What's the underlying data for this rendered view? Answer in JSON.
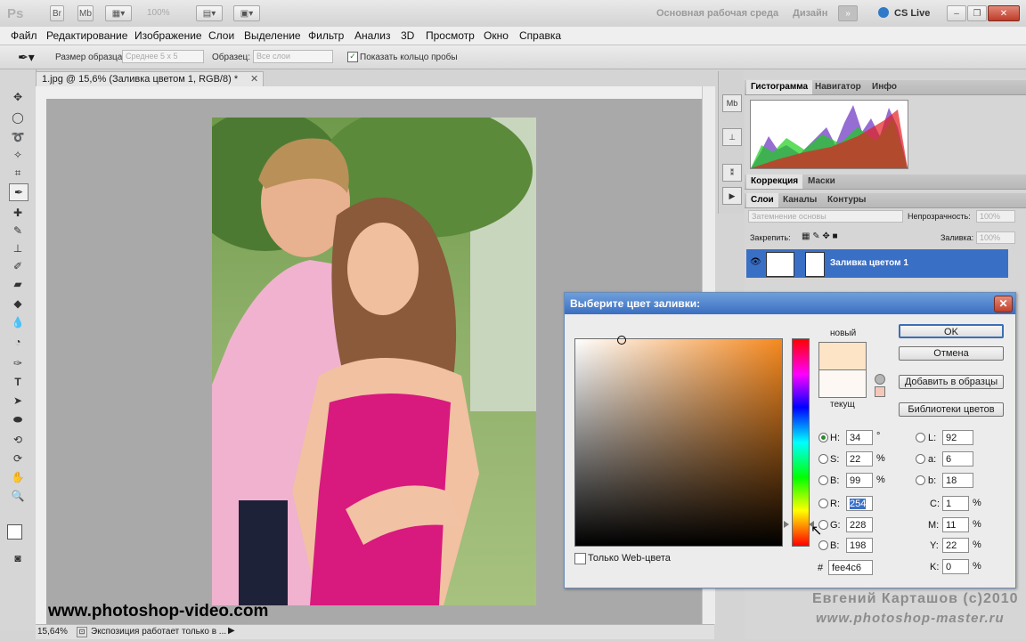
{
  "app": {
    "logo": "Ps",
    "zoom": "100%"
  },
  "titlebar": {
    "workspace_main": "Основная рабочая среда",
    "workspace_design": "Дизайн",
    "cs_live": "CS Live"
  },
  "menu": [
    "Файл",
    "Редактирование",
    "Изображение",
    "Слои",
    "Выделение",
    "Фильтр",
    "Анализ",
    "3D",
    "Просмотр",
    "Окно",
    "Справка"
  ],
  "options": {
    "sample_size_label": "Размер образца:",
    "sample_size_value": "Среднее 5 х 5",
    "sample_label": "Образец:",
    "sample_value": "Все слои",
    "show_ring": "Показать кольцо пробы"
  },
  "document": {
    "tab_title": "1.jpg @ 15,6% (Заливка цветом 1, RGB/8) *",
    "status_zoom": "15,64%",
    "status_text": "Экспозиция работает только в ..."
  },
  "watermark": {
    "site": "www.photoshop-video.com",
    "author": "Евгений Карташов (c)2010",
    "author_site": "www.photoshop-master.ru"
  },
  "panels": {
    "histogram_tabs": [
      "Гистограмма",
      "Навигатор",
      "Инфо"
    ],
    "correction_tabs": [
      "Коррекция",
      "Маски"
    ],
    "layers_tabs": [
      "Слои",
      "Каналы",
      "Контуры"
    ],
    "blend_mode": "Затемнение основы",
    "opacity_label": "Непрозрачность:",
    "opacity_value": "100%",
    "lock_label": "Закрепить:",
    "fill_label": "Заливка:",
    "fill_value": "100%",
    "layer_name": "Заливка цветом 1"
  },
  "dialog": {
    "title": "Выберите цвет заливки:",
    "new_label": "новый",
    "current_label": "текущ",
    "new_color": "#fee4c6",
    "current_color": "#fef8f4",
    "buttons": {
      "ok": "OK",
      "cancel": "Отмена",
      "add_swatch": "Добавить в образцы",
      "libraries": "Библиотеки цветов"
    },
    "web_only": "Только Web-цвета",
    "fields": {
      "H": "34",
      "S": "22",
      "B": "99",
      "R": "254",
      "G": "228",
      "Bv": "198",
      "L": "92",
      "a": "6",
      "b": "18",
      "C": "1",
      "M": "11",
      "Y": "22",
      "K": "0",
      "hex": "fee4c6"
    },
    "units": {
      "deg": "°",
      "pct": "%"
    },
    "labels": {
      "H": "H:",
      "S": "S:",
      "B": "B:",
      "R": "R:",
      "G": "G:",
      "Bv": "B:",
      "L": "L:",
      "a": "a:",
      "b": "b:",
      "C": "C:",
      "M": "M:",
      "Y": "Y:",
      "K": "K:",
      "hash": "#"
    }
  }
}
